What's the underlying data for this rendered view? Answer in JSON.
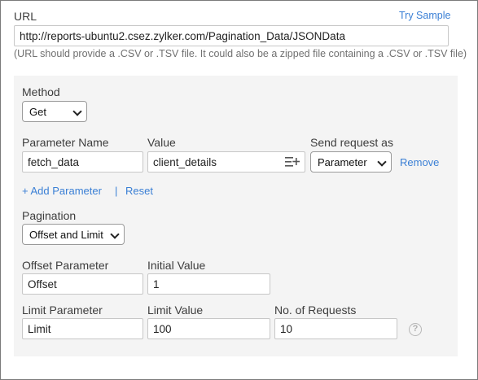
{
  "url_section": {
    "label": "URL",
    "try_sample": "Try Sample",
    "value": "http://reports-ubuntu2.csez.zylker.com/Pagination_Data/JSONData",
    "hint": "(URL should provide a .CSV or .TSV file. It could also be a zipped file containing a .CSV or .TSV file)"
  },
  "method": {
    "label": "Method",
    "selected": "Get"
  },
  "parameters": {
    "name_header": "Parameter Name",
    "value_header": "Value",
    "send_header": "Send request as",
    "row": {
      "name": "fetch_data",
      "value": "client_details",
      "send_as": "Parameter",
      "remove": "Remove"
    },
    "add_label": "+ Add Parameter",
    "separator": "|",
    "reset_label": "Reset"
  },
  "pagination": {
    "label": "Pagination",
    "selected": "Offset and Limit",
    "offset_param_label": "Offset Parameter",
    "offset_param_value": "Offset",
    "initial_value_label": "Initial Value",
    "initial_value": "1",
    "limit_param_label": "Limit Parameter",
    "limit_param_value": "Limit",
    "limit_value_label": "Limit Value",
    "limit_value": "100",
    "requests_label": "No. of Requests",
    "requests_value": "10"
  },
  "icons": {
    "insert_field": "insert-field-icon",
    "help": "help-icon"
  }
}
